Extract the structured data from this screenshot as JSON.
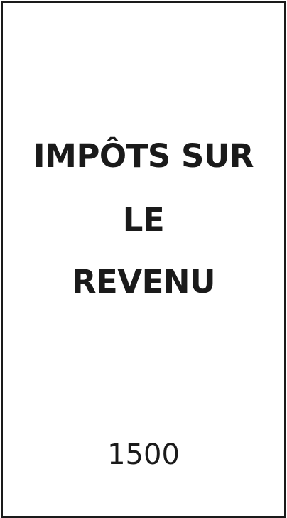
{
  "card": {
    "title_lines": [
      "IMPÔTS SUR",
      "LE",
      "REVENU"
    ],
    "amount": "1500"
  }
}
